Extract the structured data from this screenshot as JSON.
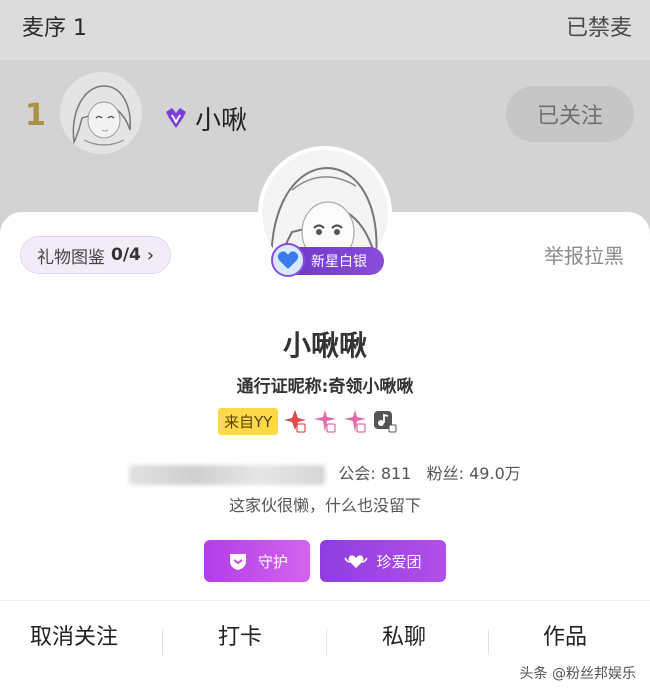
{
  "header": {
    "mic_title": "麦序 1",
    "banned_label": "已禁麦"
  },
  "row": {
    "rank": "1",
    "name": "小啾",
    "follow_button": "已关注"
  },
  "card": {
    "gift_book_label": "礼物图鉴",
    "gift_book_count": "0/4",
    "report_label": "举报拉黑",
    "level_badge": "新星白银",
    "nickname": "小啾啾",
    "passport_name": "通行证昵称:奇领小啾啾",
    "from_tag": "来自YY",
    "union_label": "公会: 811",
    "fans_label": "粉丝: 49.0万",
    "bio": "这家伙很懒，什么也没留下",
    "guard_button": "守护",
    "fan_club_button": "珍爱团"
  },
  "bottom_bar": {
    "unfollow": "取消关注",
    "checkin": "打卡",
    "chat": "私聊",
    "works": "作品"
  },
  "watermark": "头条 @粉丝邦娱乐",
  "colors": {
    "accent_purple": "#7a3fd6",
    "yy_yellow": "#ffd94a",
    "rank_gold": "#a8923f"
  }
}
